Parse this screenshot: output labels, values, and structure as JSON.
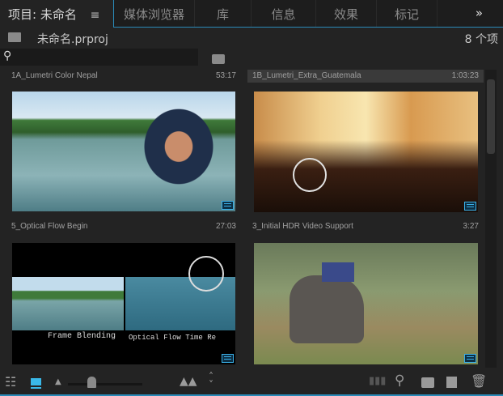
{
  "panel": {
    "title": "项目: 未命名",
    "menu_icon": "hamburger-icon",
    "tabs": [
      {
        "label": "媒体浏览器"
      },
      {
        "label": "库"
      },
      {
        "label": "信息"
      },
      {
        "label": "效果"
      },
      {
        "label": "标记"
      }
    ],
    "overflow_icon": "double-chevron-right-icon"
  },
  "project": {
    "file": "未命名.prproj",
    "count": "8 个项"
  },
  "search": {
    "placeholder": "",
    "value": ""
  },
  "clips": [
    {
      "name": "1A_Lumetri Color Nepal",
      "duration": "53:17",
      "selected": false
    },
    {
      "name": "1B_Lumetri_Extra_Guatemala",
      "duration": "1:03:23",
      "selected": true
    },
    {
      "name": "5_Optical Flow Begin",
      "duration": "27:03",
      "selected": false
    },
    {
      "name": "3_Initial HDR Video Support",
      "duration": "3:27",
      "selected": false
    }
  ],
  "overlay_text": {
    "frame_blending": "Frame Blending",
    "optical_flow": "Optical Flow Time Re"
  },
  "toolbar": {
    "zoom_level": 0.3
  },
  "colors": {
    "accent": "#2a8ab8",
    "background": "#232323"
  }
}
